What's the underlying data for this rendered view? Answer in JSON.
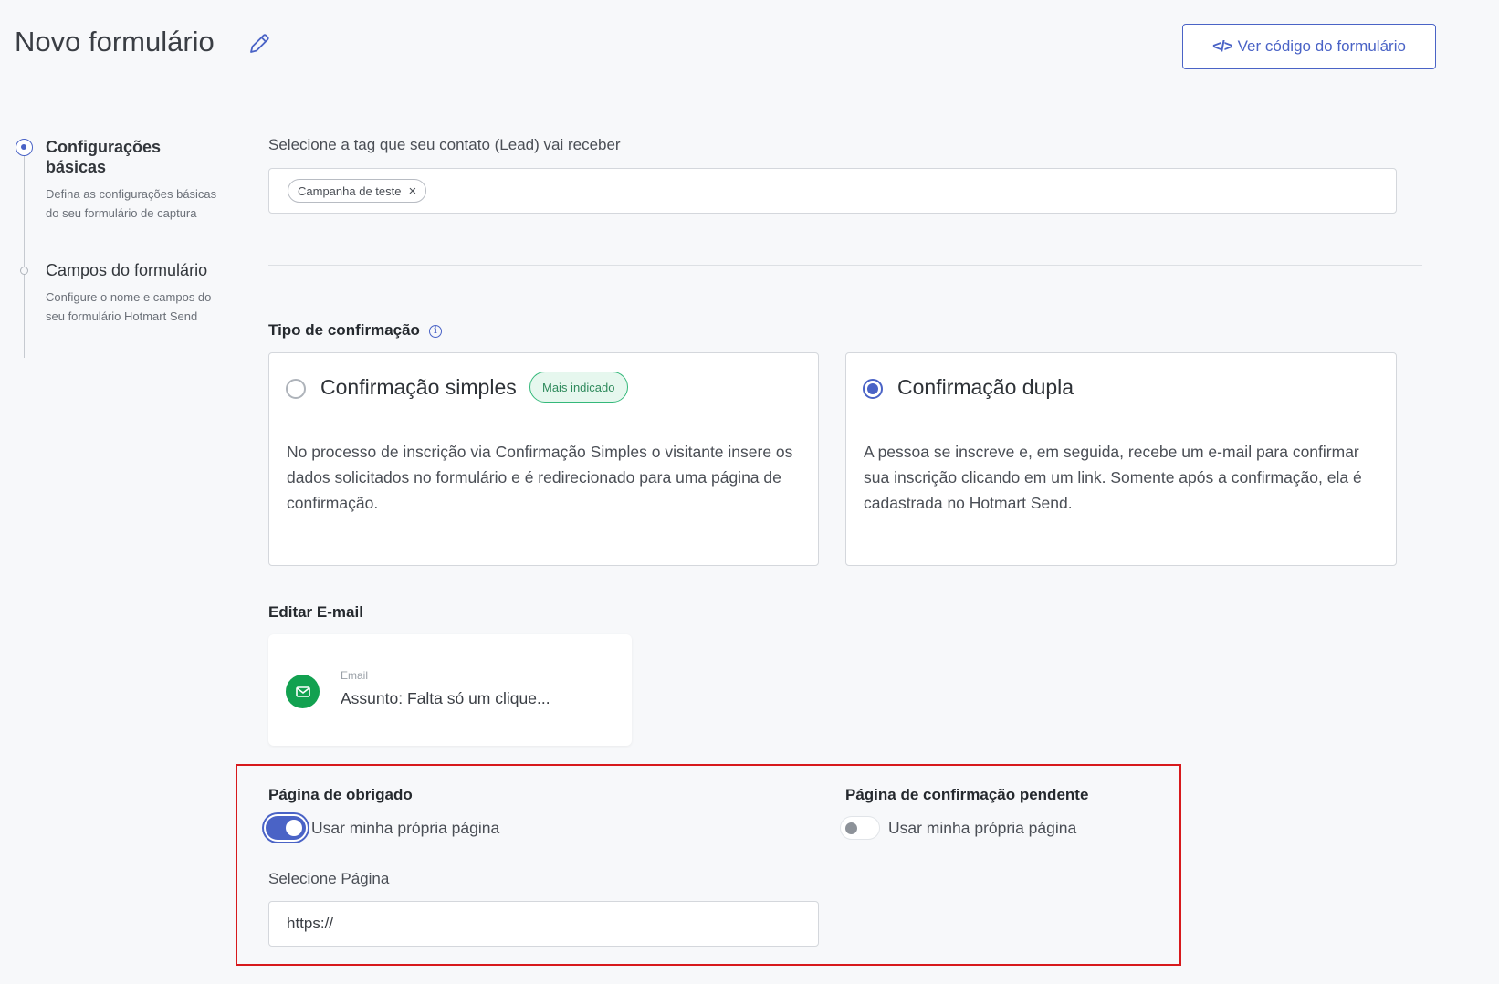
{
  "header": {
    "title": "Novo formulário",
    "code_button_glyph": "</>",
    "code_button_label": "Ver código do formulário"
  },
  "stepper": {
    "steps": [
      {
        "title": "Configurações básicas",
        "description": "Defina as configurações básicas do seu formulário de captura",
        "state": "active"
      },
      {
        "title": "Campos do formulário",
        "description": "Configure o nome e campos do seu formulário Hotmart Send",
        "state": "inactive"
      }
    ]
  },
  "tag_section": {
    "label": "Selecione a tag que seu contato (Lead) vai receber",
    "chips": [
      "Campanha de teste"
    ],
    "remove_glyph": "×"
  },
  "confirmation": {
    "label": "Tipo de confirmação",
    "info_glyph": "i",
    "options": [
      {
        "title": "Confirmação simples",
        "badge": "Mais indicado",
        "description": "No processo de inscrição via Confirmação Simples o visitante insere os dados solicitados no formulário e é redirecionado para uma página de confirmação.",
        "selected": false
      },
      {
        "title": "Confirmação dupla",
        "description": "A pessoa se inscreve e, em seguida, recebe um e-mail para confirmar sua inscrição clicando em um link. Somente após a confirmação, ela é cadastrada no Hotmart Send.",
        "selected": true
      }
    ]
  },
  "email": {
    "section_label": "Editar E-mail",
    "type_label": "Email",
    "subject": "Assunto: Falta só um clique...",
    "icon_color": "#12a150"
  },
  "thank_you_page": {
    "label": "Página de obrigado",
    "toggle_label": "Usar minha própria página",
    "toggle_on": true,
    "select_label": "Selecione Página",
    "url_value": "https://"
  },
  "pending_page": {
    "label": "Página de confirmação pendente",
    "toggle_label": "Usar minha própria página",
    "toggle_on": false
  },
  "colors": {
    "accent": "#4a63c6",
    "success": "#34b87a",
    "highlight_border": "#d7191c",
    "background": "#f7f8fa"
  }
}
